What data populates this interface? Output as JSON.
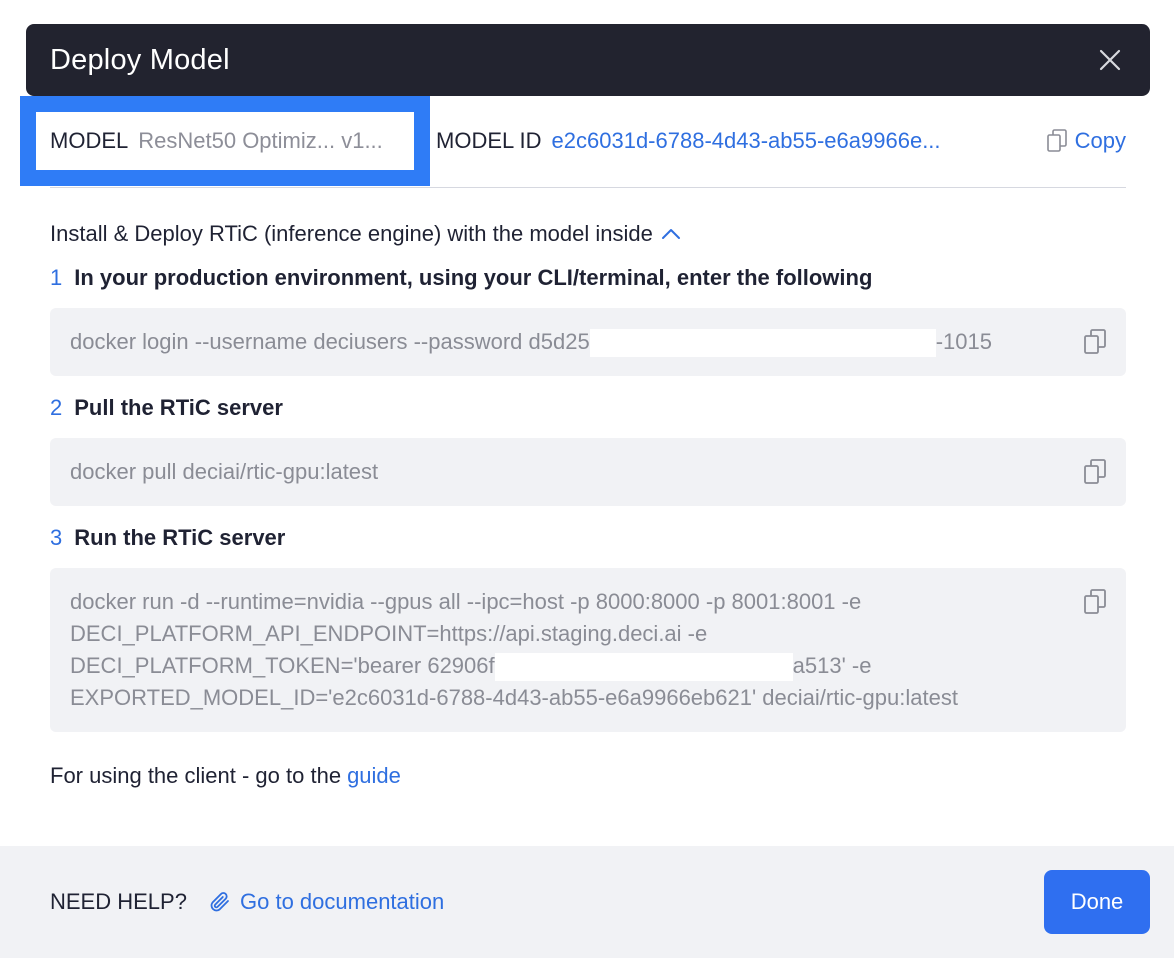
{
  "header": {
    "title": "Deploy Model",
    "close_icon": "close-icon"
  },
  "model": {
    "label": "MODEL",
    "name": "ResNet50 Optimiz... v1..."
  },
  "model_id": {
    "label": "MODEL ID",
    "value": "e2c6031d-6788-4d43-ab55-e6a9966e...",
    "copy_label": "Copy",
    "copy_icon": "copy-icon"
  },
  "install": {
    "text": "Install & Deploy RTiC (inference engine) with the model inside",
    "toggle_icon": "chevron-up-icon"
  },
  "steps": [
    {
      "number": "1",
      "title": "In your production environment, using your CLI/terminal, enter the following",
      "code_parts": [
        "docker login --username deciusers --password d5d25",
        "-1015"
      ]
    },
    {
      "number": "2",
      "title": "Pull the RTiC server",
      "code": "docker pull deciai/rtic-gpu:latest"
    },
    {
      "number": "3",
      "title": "Run the RTiC server",
      "code_lines": [
        "docker run -d --runtime=nvidia --gpus all --ipc=host -p 8000:8000 -p 8001:8001 -e",
        "DECI_PLATFORM_API_ENDPOINT=https://api.staging.deci.ai -e",
        "DECI_PLATFORM_TOKEN='bearer 62906f",
        "a513' -e",
        "EXPORTED_MODEL_ID='e2c6031d-6788-4d43-ab55-e6a9966eb621' deciai/rtic-gpu:latest"
      ]
    }
  ],
  "client": {
    "text": "For using the client - go to the",
    "link": "guide"
  },
  "footer": {
    "help_label": "NEED HELP?",
    "doc_link": "Go to documentation",
    "doc_icon": "paperclip-icon",
    "done_label": "Done"
  },
  "colors": {
    "accent": "#2f6ff0",
    "header_bg": "#22232f",
    "code_bg": "#f1f2f5",
    "highlight": "#2f7cf6"
  }
}
